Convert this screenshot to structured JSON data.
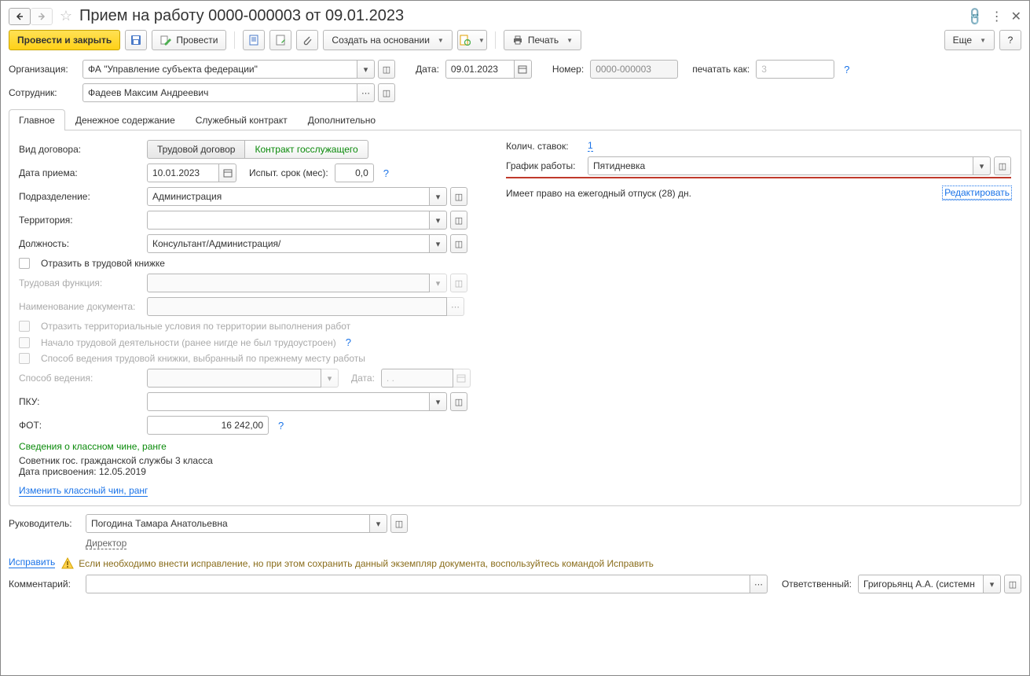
{
  "title": "Прием на работу 0000-000003 от 09.01.2023",
  "cmdbar": {
    "post_close": "Провести и закрыть",
    "post": "Провести",
    "create_based": "Создать на основании",
    "print": "Печать",
    "more": "Еще"
  },
  "header": {
    "org_label": "Организация:",
    "org_value": "ФА \"Управление субъекта федерации\"",
    "date_label": "Дата:",
    "date_value": "09.01.2023",
    "number_label": "Номер:",
    "number_value": "0000-000003",
    "print_as_label": "печатать как:",
    "print_as_value": "3",
    "employee_label": "Сотрудник:",
    "employee_value": "Фадеев Максим Андреевич"
  },
  "tabs": {
    "main": "Главное",
    "money": "Денежное содержание",
    "contract": "Служебный контракт",
    "extra": "Дополнительно"
  },
  "main": {
    "contract_type_label": "Вид договора:",
    "contract_type_labor": "Трудовой договор",
    "contract_type_gov": "Контракт госслужащего",
    "hire_date_label": "Дата приема:",
    "hire_date_value": "10.01.2023",
    "trial_label": "Испыт. срок (мес):",
    "trial_value": "0,0",
    "division_label": "Подразделение:",
    "division_value": "Администрация",
    "territory_label": "Территория:",
    "territory_value": "",
    "position_label": "Должность:",
    "position_value": "Консультант/Администрация/",
    "reflect_labor_book": "Отразить в трудовой книжке",
    "labor_function_label": "Трудовая функция:",
    "doc_name_label": "Наименование документа:",
    "reflect_territory": "Отразить территориальные условия по территории выполнения работ",
    "first_employment": "Начало трудовой деятельности (ранее нигде не был трудоустроен)",
    "book_method": "Способ ведения трудовой книжки, выбранный по прежнему месту работы",
    "method_label": "Способ ведения:",
    "method_date_label": "Дата:",
    "method_date_value": "  .  .",
    "pku_label": "ПКУ:",
    "fot_label": "ФОТ:",
    "fot_value": "16 242,00",
    "rank_head": "Сведения о классном чине, ранге",
    "rank_line1": "Советник гос. гражданской службы 3 класса",
    "rank_line2": "Дата присвоения: 12.05.2019",
    "change_rank": "Изменить классный чин, ранг",
    "stake_count_label": "Колич. ставок:",
    "stake_count_value": "1",
    "schedule_label": "График работы:",
    "schedule_value": "Пятидневка",
    "vacation_text": "Имеет право на ежегодный отпуск (28) дн.",
    "vacation_edit": "Редактировать"
  },
  "footer": {
    "manager_label": "Руководитель:",
    "manager_value": "Погодина Тамара Анатольевна",
    "manager_pos": "Директор",
    "fix_link": "Исправить",
    "fix_text": "Если необходимо внести исправление, но при этом сохранить данный экземпляр документа, воспользуйтесь командой Исправить",
    "comment_label": "Комментарий:",
    "responsible_label": "Ответственный:",
    "responsible_value": "Григорьянц А.А. (системн"
  }
}
